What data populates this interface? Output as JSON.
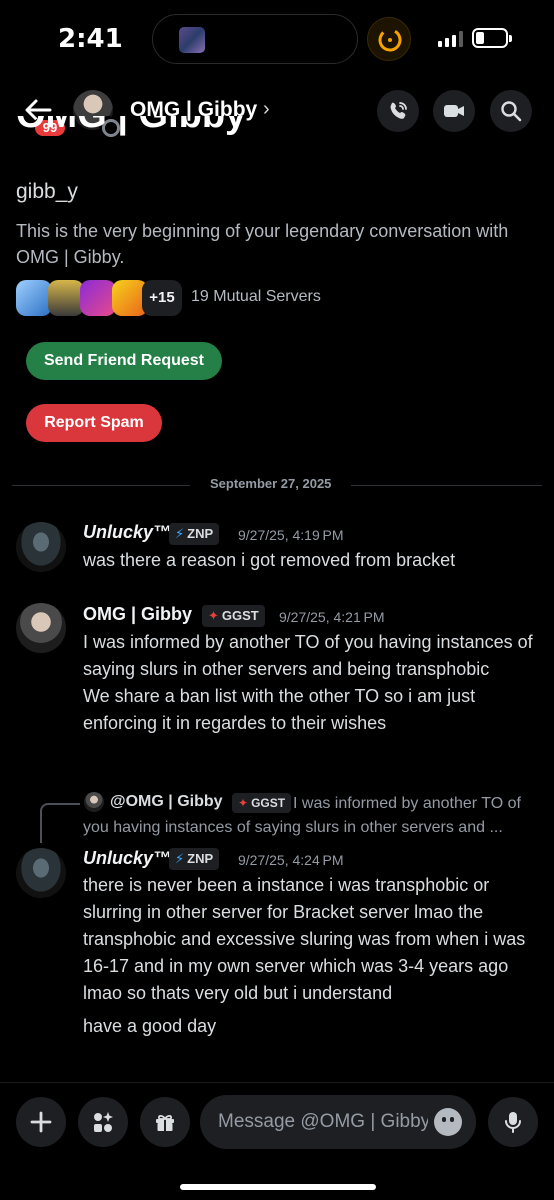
{
  "status_bar": {
    "time": "2:41"
  },
  "header": {
    "unread_count": "99",
    "title": "OMG | Gibby",
    "chevron": "›",
    "icons": [
      "back-arrow-icon",
      "phone-call-icon",
      "video-camera-icon",
      "search-icon"
    ]
  },
  "profile": {
    "display_name": "OMG | Gibby",
    "username": "gibb_y",
    "intro": "This is the very beginning of your legendary conversation with OMG | Gibby.",
    "extra_servers": "+15",
    "mutual_servers": "19 Mutual Servers",
    "send_friend_request": "Send Friend Request",
    "report_spam": "Report Spam"
  },
  "date_divider": "September 27, 2025",
  "messages": [
    {
      "author": "Unlucky™",
      "tag": "ZNP",
      "timestamp": "9/27/25, 4:19 PM",
      "lines": [
        "was there a reason i got removed from bracket"
      ]
    },
    {
      "author": "OMG | Gibby",
      "tag": "GGST",
      "timestamp": "9/27/25, 4:21 PM",
      "lines": [
        "I was informed by another TO of you having instances of saying slurs in other servers and being transphobic",
        "We share a ban list with the other TO so i am just enforcing it in regardes to their wishes"
      ]
    },
    {
      "reply": {
        "author": "@OMG | Gibby",
        "tag": "GGST",
        "text": "I was informed by another TO of you having instances of saying slurs in other servers and ..."
      },
      "author": "Unlucky™",
      "tag": "ZNP",
      "timestamp": "9/27/25, 4:24 PM",
      "lines": [
        "there is never been a instance i was transphobic or slurring in other server for Bracket server lmao the transphobic and excessive sluring was from when i was 16-17 and in my own server which was 3-4 years ago lmao so thats very old but i understand",
        "have a good day"
      ]
    }
  ],
  "composer": {
    "placeholder": "Message @OMG | Gibby"
  },
  "colors": {
    "background": "#000000",
    "friend_button": "#248046",
    "spam_button": "#da373c",
    "badge": "#e93b3b",
    "tag_bg": "#1e1f22"
  }
}
